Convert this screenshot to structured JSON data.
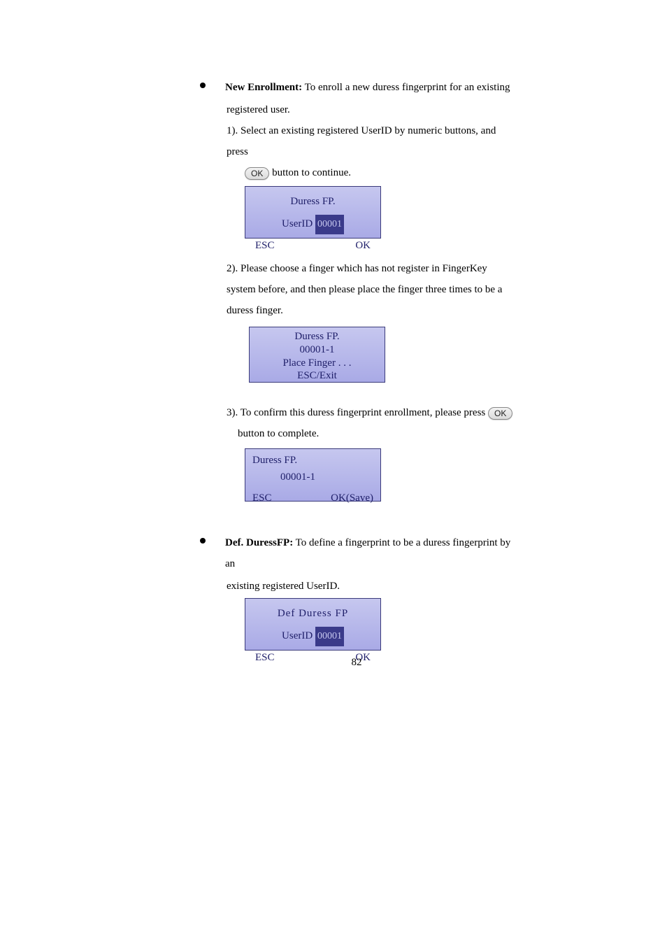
{
  "section1": {
    "title": "New Enrollment:",
    "desc1": " To enroll a new duress fingerprint for an existing",
    "desc2": "registered user.",
    "step1a": "1). Select an existing registered UserID by numeric buttons, and press",
    "ok_label": "OK",
    "step1b": " button to continue.",
    "screen1": {
      "title": "Duress  FP.",
      "userid_label": "UserID",
      "userid_value": "00001",
      "esc": "ESC",
      "ok": "OK"
    },
    "step2": "2). Please choose a finger which has not register in FingerKey system before, and then please place the finger three times to be a duress finger.",
    "screen2": {
      "line1": "Duress  FP.",
      "line2": "00001-1",
      "line3": "Place Finger . . .",
      "line4": "ESC/Exit"
    },
    "step3a": "3). To confirm this duress fingerprint enrollment, please press ",
    "step3b": "button to complete.",
    "screen3": {
      "line1": "Duress  FP.",
      "line2": "00001-1",
      "esc": "ESC",
      "ok": "OK(Save)"
    }
  },
  "section2": {
    "title": "Def. DuressFP:",
    "desc1": " To define a fingerprint to be a duress fingerprint by an",
    "desc2": "existing registered UserID.",
    "screen4": {
      "title": "Def   Duress   FP",
      "userid_label": "UserID",
      "userid_value": "00001",
      "esc": "ESC",
      "ok": "OK"
    }
  },
  "page_number": "82"
}
